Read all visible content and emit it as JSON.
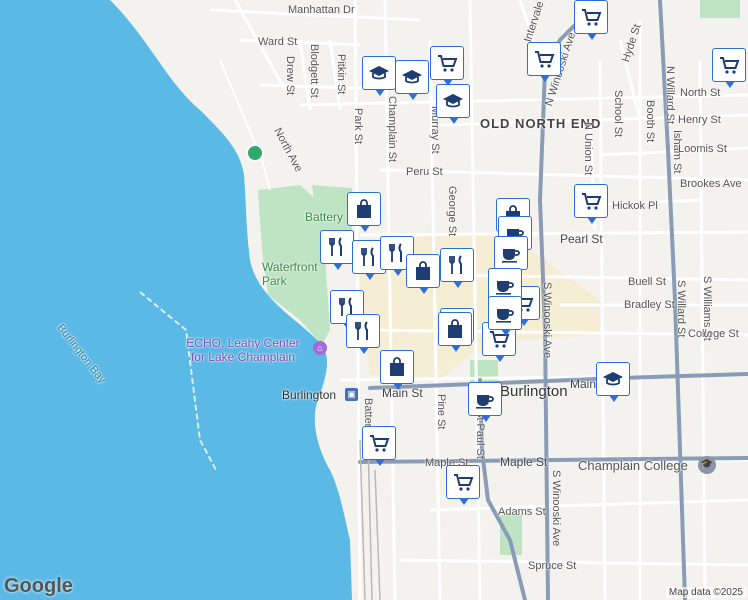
{
  "map": {
    "attribution": "Map data ©2025",
    "logo": "Google",
    "colors": {
      "water": "#5bb9e6",
      "land": "#f3f2ef",
      "park": "#bfe4c4",
      "highway": "#8a9bb5",
      "pin_border": "#2d6fd6",
      "pin_icon": "#1d3d73"
    }
  },
  "labels": {
    "neighborhood": "OLD NORTH END",
    "city": "Burlington",
    "bay": "Burlington Bay",
    "park_waterfront": "Waterfront Park",
    "park_battery": "Battery",
    "poi_echo": "ECHO, Leahy Center for Lake Champlain",
    "poi_station": "Burlington",
    "college": "Champlain College",
    "streets": {
      "manhattan": "Manhattan Dr",
      "ward": "Ward St",
      "drew": "Drew St",
      "blodgett": "Blodgett St",
      "pitkin": "Pitkin St",
      "north_ave": "North Ave",
      "park": "Park St",
      "champlain": "Champlain St",
      "murray": "Murray St",
      "peru": "Peru St",
      "george": "George St",
      "intervale": "Intervale Ave",
      "n_winooski": "N Winooski Ave",
      "hyde": "Hyde St",
      "school": "School St",
      "n_union": "N Union St",
      "booth": "Booth St",
      "isham": "Isham St",
      "n_willard": "N Willard St",
      "north_st": "North St",
      "henry": "Henry St",
      "loomis": "Loomis St",
      "brookes": "Brookes Ave",
      "hickok": "Hickok Pl",
      "pearl": "Pearl St",
      "buell": "Buell St",
      "bradley": "Bradley St",
      "college_st": "College St",
      "s_winooski": "S Winooski Ave",
      "s_willard": "S Willard St",
      "s_williams": "S Williams St",
      "main": "Main St",
      "maple": "Maple St",
      "adams": "Adams St",
      "spruce": "Spruce St",
      "pine": "Pine St",
      "st_paul": "St Paul St",
      "battery": "Battery St",
      "s_winooski_lower": "S Winooski Ave"
    }
  },
  "pins": [
    {
      "icon": "shopping-cart"
    },
    {
      "icon": "shopping-cart"
    },
    {
      "icon": "shopping-cart"
    },
    {
      "icon": "graduation-cap"
    },
    {
      "icon": "graduation-cap"
    },
    {
      "icon": "shopping-cart"
    },
    {
      "icon": "graduation-cap"
    },
    {
      "icon": "shopping-cart"
    },
    {
      "icon": "shopping-bag"
    },
    {
      "icon": "restaurant"
    },
    {
      "icon": "restaurant"
    },
    {
      "icon": "restaurant"
    },
    {
      "icon": "shopping-bag"
    },
    {
      "icon": "restaurant"
    },
    {
      "icon": "shopping-bag"
    },
    {
      "icon": "coffee-cup"
    },
    {
      "icon": "coffee-cup"
    },
    {
      "icon": "shopping-cart"
    },
    {
      "icon": "restaurant"
    },
    {
      "icon": "restaurant"
    },
    {
      "icon": "shopping-bag"
    },
    {
      "icon": "shopping-cart"
    },
    {
      "icon": "shopping-bag"
    },
    {
      "icon": "coffee-cup"
    },
    {
      "icon": "coffee-cup"
    },
    {
      "icon": "shopping-bag"
    },
    {
      "icon": "graduation-cap"
    },
    {
      "icon": "coffee-cup"
    },
    {
      "icon": "shopping-cart"
    },
    {
      "icon": "shopping-cart"
    }
  ]
}
